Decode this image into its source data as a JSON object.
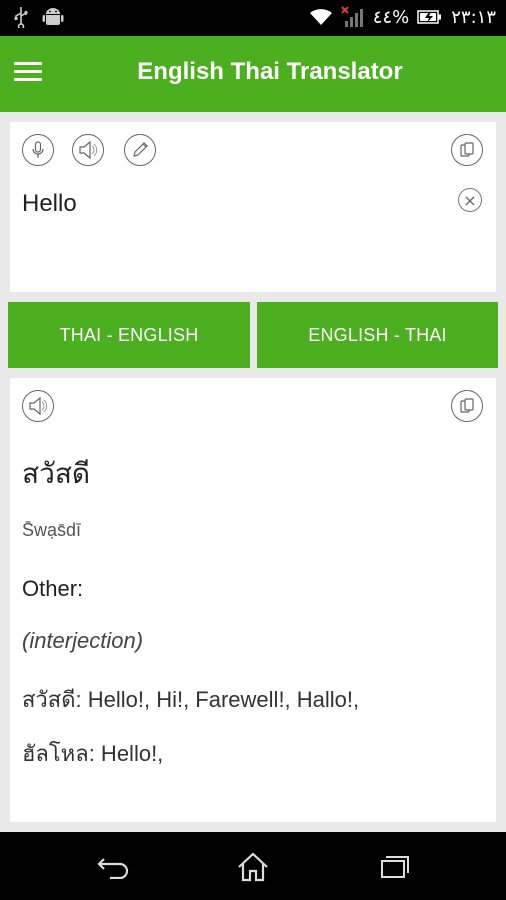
{
  "status_bar": {
    "battery_percent": "٤٤%",
    "time": "٢٣:١٣",
    "icons": [
      "usb-icon",
      "android-icon",
      "wifi-icon",
      "signal-icon",
      "battery-icon"
    ]
  },
  "app_bar": {
    "title": "English Thai Translator",
    "menu_icon": "hamburger-menu-icon",
    "color": "#4caf1f"
  },
  "input_card": {
    "text": "Hello",
    "buttons": [
      "microphone-icon",
      "speaker-icon",
      "pencil-icon",
      "copy-icon"
    ],
    "clear_icon": "×"
  },
  "direction_buttons": {
    "left_label": "THAI - ENGLISH",
    "right_label": "ENGLISH - THAI"
  },
  "output_card": {
    "main_translation": "สวัสดี",
    "transliteration": "S̄wạs̄dī",
    "other_label": "Other:",
    "part_of_speech": "(interjection)",
    "entries": [
      "สวัสดี: Hello!, Hi!, Farewell!, Hallo!,",
      "ฮัลโหล: Hello!,"
    ],
    "buttons": [
      "speaker-icon",
      "copy-icon"
    ]
  },
  "nav_bar": {
    "icons": [
      "back-icon",
      "home-icon",
      "recent-apps-icon"
    ]
  }
}
